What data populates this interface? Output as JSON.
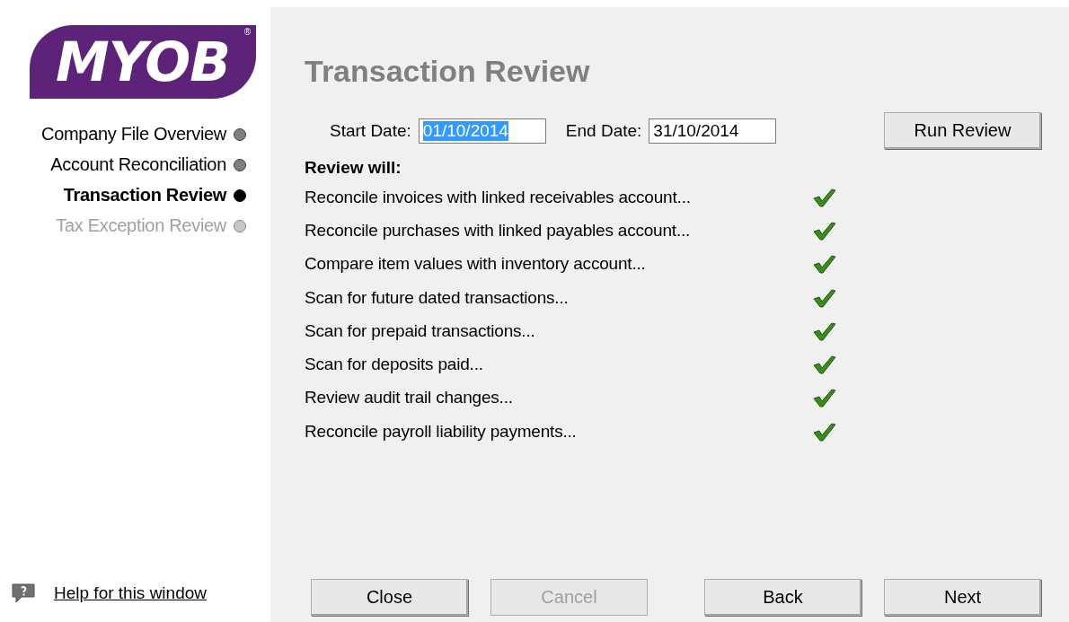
{
  "logo": {
    "text": "MYOB",
    "mark": "®"
  },
  "steps": [
    {
      "label": "Company File Overview",
      "selected": false,
      "disabled": false
    },
    {
      "label": "Account Reconciliation",
      "selected": false,
      "disabled": false
    },
    {
      "label": "Transaction Review",
      "selected": true,
      "disabled": false
    },
    {
      "label": "Tax Exception Review",
      "selected": false,
      "disabled": true
    }
  ],
  "help_link": "Help for this window",
  "title": "Transaction Review",
  "start_date": {
    "label": "Start Date:",
    "value": "01/10/2014",
    "selected": true
  },
  "end_date": {
    "label": "End Date:",
    "value": "31/10/2014",
    "selected": false
  },
  "run_button": {
    "label": "Run Review",
    "disabled": false
  },
  "review_heading": "Review will:",
  "checks": [
    {
      "label": "Reconcile invoices with linked receivables account...",
      "checked": true
    },
    {
      "label": "Reconcile purchases with linked payables account...",
      "checked": true
    },
    {
      "label": "Compare item values with inventory account...",
      "checked": true
    },
    {
      "label": "Scan for future dated transactions...",
      "checked": true
    },
    {
      "label": "Scan for prepaid transactions...",
      "checked": true
    },
    {
      "label": "Scan for deposits paid...",
      "checked": true
    },
    {
      "label": "Review audit trail changes...",
      "checked": true
    },
    {
      "label": "Reconcile payroll liability payments...",
      "checked": true
    }
  ],
  "buttons": [
    {
      "label": "Close",
      "disabled": false
    },
    {
      "label": "Cancel",
      "disabled": true
    },
    {
      "label": "Back",
      "disabled": false
    },
    {
      "label": "Next",
      "disabled": false
    }
  ]
}
